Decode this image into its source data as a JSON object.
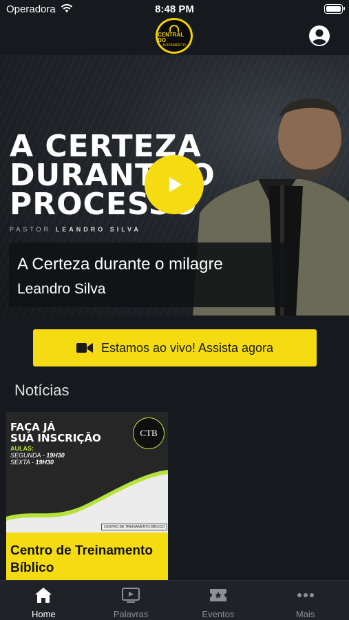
{
  "status_bar": {
    "carrier": "Operadora",
    "time": "8:48 PM"
  },
  "header": {
    "logo_line1": "CENTRAL DO",
    "logo_line2": "AVIVAMENTO"
  },
  "hero": {
    "poster_lines": [
      "A CERTEZA",
      "DURANTE O",
      "PROCESSO"
    ],
    "poster_pastor_prefix": "PASTOR",
    "poster_pastor_name": "LEANDRO SILVA",
    "title": "A Certeza durante o milagre",
    "speaker": "Leandro Silva"
  },
  "live_button": {
    "label": "Estamos ao vivo! Assista agora",
    "icon": "video-camera-icon"
  },
  "news": {
    "section_title": "Notícias",
    "items": [
      {
        "headline_lines": [
          "FAÇA JÁ",
          "SUA INSCRIÇÃO"
        ],
        "aulas_label": "AULAS:",
        "day1": "SEGUNDA",
        "time1": "19H30",
        "day2": "SEXTA",
        "time2": "19H30",
        "badge": "CTB",
        "footer_tag": "CENTRO DE TREINAMENTO BÍBLICO",
        "caption": "Centro de Treinamento Bíblico"
      }
    ]
  },
  "tabs": [
    {
      "label": "Home",
      "icon": "home-icon",
      "active": true
    },
    {
      "label": "Palavras",
      "icon": "tv-play-icon",
      "active": false
    },
    {
      "label": "Eventos",
      "icon": "ticket-star-icon",
      "active": false
    },
    {
      "label": "Mais",
      "icon": "more-dots-icon",
      "active": false
    }
  ],
  "colors": {
    "accent": "#f5dc12",
    "background": "#16191d",
    "green": "#b7e23c"
  }
}
